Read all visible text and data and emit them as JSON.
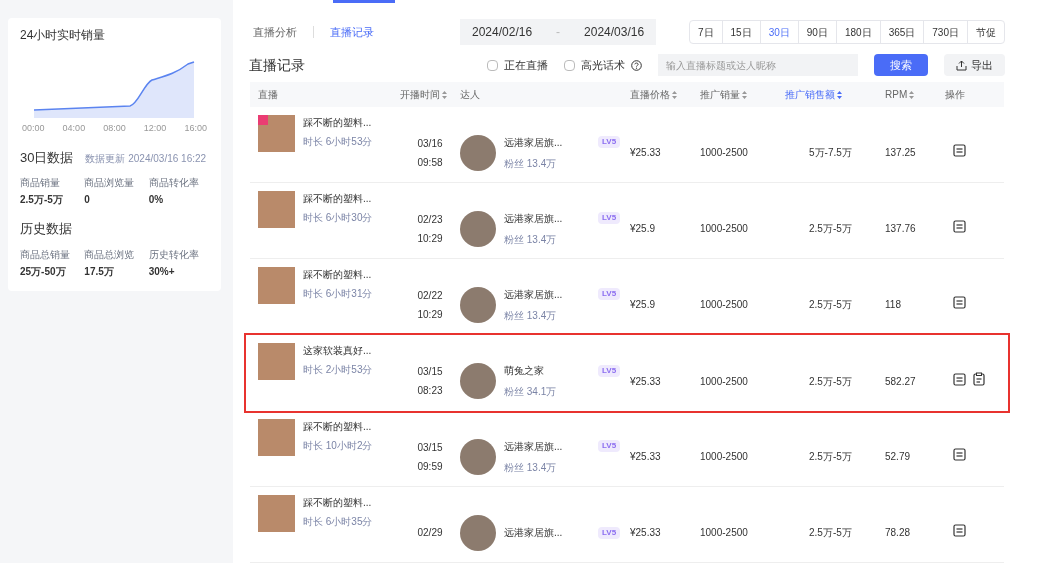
{
  "side_panel": {
    "chart": {
      "title": "24小时实时销量",
      "x_labels": [
        "00:00",
        "04:00",
        "08:00",
        "12:00",
        "16:00"
      ]
    },
    "recent": {
      "title": "30日数据",
      "updated": "数据更新 2024/03/16 16:22",
      "stats": [
        {
          "label": "商品销量",
          "value": "2.5万-5万"
        },
        {
          "label": "商品浏览量",
          "value": "0"
        },
        {
          "label": "商品转化率",
          "value": "0%"
        }
      ]
    },
    "history": {
      "title": "历史数据",
      "stats": [
        {
          "label": "商品总销量",
          "value": "25万-50万"
        },
        {
          "label": "商品总浏览",
          "value": "17.5万"
        },
        {
          "label": "历史转化率",
          "value": "30%+"
        }
      ]
    }
  },
  "tabs": [
    {
      "label": "直播分析",
      "selected": false
    },
    {
      "label": "直播记录",
      "selected": true
    }
  ],
  "date_range": {
    "start": "2024/02/16",
    "separator": "-",
    "end": "2024/03/16"
  },
  "periods": [
    {
      "label": "7日",
      "selected": false
    },
    {
      "label": "15日",
      "selected": false
    },
    {
      "label": "30日",
      "selected": true
    },
    {
      "label": "90日",
      "selected": false
    },
    {
      "label": "180日",
      "selected": false
    },
    {
      "label": "365日",
      "selected": false
    },
    {
      "label": "730日",
      "selected": false
    },
    {
      "label": "节促",
      "selected": false
    }
  ],
  "section_title": "直播记录",
  "filters": [
    {
      "label": "正在直播",
      "checked": false
    },
    {
      "label": "高光话术",
      "checked": false,
      "help": true
    }
  ],
  "search": {
    "placeholder": "输入直播标题或达人昵称",
    "button": "搜索"
  },
  "export_button": "导出",
  "table": {
    "columns": [
      {
        "label": "直播",
        "sortable": false,
        "selected": false
      },
      {
        "label": "开播时间",
        "sortable": true,
        "selected": false
      },
      {
        "label": "达人",
        "sortable": false,
        "selected": false
      },
      {
        "label": "直播价格",
        "sortable": true,
        "selected": false
      },
      {
        "label": "推广销量",
        "sortable": true,
        "selected": false
      },
      {
        "label": "推广销售额",
        "sortable": true,
        "selected": true
      },
      {
        "label": "RPM",
        "sortable": true,
        "selected": false
      },
      {
        "label": "操作",
        "sortable": false,
        "selected": false
      }
    ],
    "rows": [
      {
        "title": "踩不断的塑料...",
        "duration": "时长 6小时53分",
        "replay_badge": true,
        "date": "03/16",
        "time": "09:58",
        "name": "远港家居旗...",
        "level": "LV5",
        "fans": "粉丝 13.4万",
        "price": "¥25.33",
        "sales": "1000-2500",
        "revenue": "5万-7.5万",
        "rpm": "137.25",
        "highlighted": false,
        "actions": [
          {
            "kind": "detail"
          }
        ]
      },
      {
        "title": "踩不断的塑料...",
        "duration": "时长 6小时30分",
        "replay_badge": false,
        "date": "02/23",
        "time": "10:29",
        "name": "远港家居旗...",
        "level": "LV5",
        "fans": "粉丝 13.4万",
        "price": "¥25.9",
        "sales": "1000-2500",
        "revenue": "2.5万-5万",
        "rpm": "137.76",
        "highlighted": false,
        "actions": [
          {
            "kind": "detail"
          }
        ]
      },
      {
        "title": "踩不断的塑料...",
        "duration": "时长 6小时31分",
        "replay_badge": false,
        "date": "02/22",
        "time": "10:29",
        "name": "远港家居旗...",
        "level": "LV5",
        "fans": "粉丝 13.4万",
        "price": "¥25.9",
        "sales": "1000-2500",
        "revenue": "2.5万-5万",
        "rpm": "118",
        "highlighted": false,
        "actions": [
          {
            "kind": "detail"
          }
        ]
      },
      {
        "title": "这家软装真好...",
        "duration": "时长 2小时53分",
        "replay_badge": false,
        "date": "03/15",
        "time": "08:23",
        "name": "萌兔之家",
        "level": "LV5",
        "fans": "粉丝 34.1万",
        "price": "¥25.33",
        "sales": "1000-2500",
        "revenue": "2.5万-5万",
        "rpm": "582.27",
        "highlighted": true,
        "actions": [
          {
            "kind": "detail"
          },
          {
            "kind": "script"
          }
        ]
      },
      {
        "title": "踩不断的塑料...",
        "duration": "时长 10小时2分",
        "replay_badge": false,
        "date": "03/15",
        "time": "09:59",
        "name": "远港家居旗...",
        "level": "LV5",
        "fans": "粉丝 13.4万",
        "price": "¥25.33",
        "sales": "1000-2500",
        "revenue": "2.5万-5万",
        "rpm": "52.79",
        "highlighted": false,
        "actions": [
          {
            "kind": "detail"
          }
        ]
      },
      {
        "title": "踩不断的塑料...",
        "duration": "时长 6小时35分",
        "replay_badge": false,
        "date": "02/29",
        "name": "远港家居旗...",
        "level": "LV5",
        "price": "¥25.33",
        "sales": "1000-2500",
        "revenue": "2.5万-5万",
        "rpm": "78.28",
        "highlighted": false,
        "actions": [
          {
            "kind": "detail"
          }
        ]
      }
    ]
  }
}
